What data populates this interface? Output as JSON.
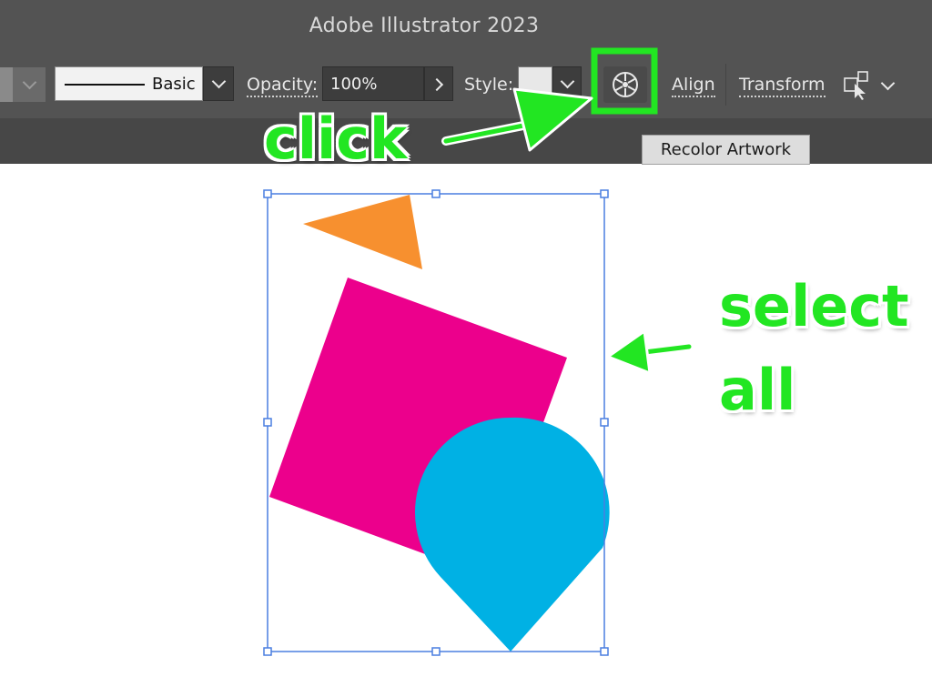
{
  "window": {
    "title": "Adobe Illustrator 2023"
  },
  "control_bar": {
    "stroke_profile": "Basic",
    "opacity_label": "Opacity:",
    "opacity_value": "100%",
    "style_label": "Style:",
    "align_label": "Align",
    "transform_label": "Transform"
  },
  "tooltip": {
    "text": "Recolor Artwork"
  },
  "annotations": {
    "click": "click",
    "select_line1": "select",
    "select_line2": "all",
    "highlight_color": "#22e622"
  },
  "artwork": {
    "colors": {
      "triangle": "#f7902f",
      "square": "#ec008c",
      "teardrop": "#00b1e4",
      "selection": "#4a7fe0"
    }
  },
  "icons": {
    "recolor": "color-wheel-icon",
    "arrange": "arrange-icon",
    "dropdown": "chevron-down-icon",
    "next": "chevron-right-icon"
  }
}
